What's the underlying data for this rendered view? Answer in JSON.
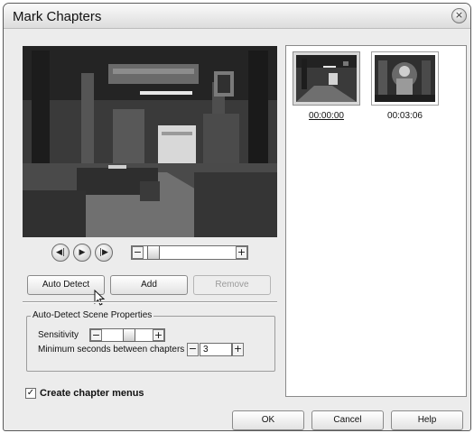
{
  "window": {
    "title": "Mark Chapters",
    "close_glyph": "×"
  },
  "transport": {
    "prev_icon": "skip-back-icon",
    "play_icon": "play-icon",
    "next_icon": "skip-forward-icon",
    "minus": "−",
    "plus": "+",
    "position_fraction": 0.05
  },
  "actions": {
    "auto_detect": "Auto Detect",
    "add": "Add",
    "remove": "Remove"
  },
  "scene_props": {
    "title": "Auto-Detect Scene Properties",
    "sensitivity_label": "Sensitivity",
    "sensitivity_fraction": 0.55,
    "min_seconds_label": "Minimum seconds between chapters",
    "min_seconds_value": "3",
    "minus": "−",
    "plus": "+"
  },
  "create_menus": {
    "label": "Create chapter menus",
    "checked": true,
    "check_glyph": "✓"
  },
  "chapters": [
    {
      "time": "00:00:00",
      "selected": true
    },
    {
      "time": "00:03:06",
      "selected": false
    }
  ],
  "footer": {
    "ok": "OK",
    "cancel": "Cancel",
    "help": "Help"
  }
}
